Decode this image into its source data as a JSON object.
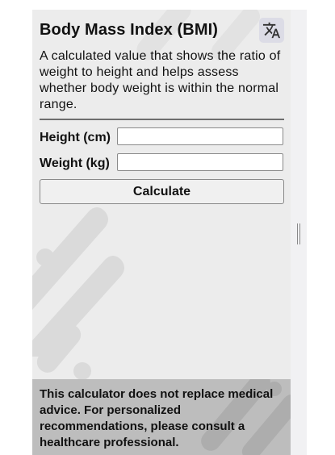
{
  "header": {
    "title": "Body Mass Index (BMI)",
    "translate_icon": "translate-icon"
  },
  "description": "A calculated value that shows the ratio of weight to height and helps assess whether body weight is within the normal range.",
  "form": {
    "height_label": "Height (cm)",
    "height_value": "",
    "weight_label": "Weight (kg)",
    "weight_value": "",
    "calculate_label": "Calculate"
  },
  "disclaimer": "This calculator does not replace medical advice. For personalized recommendations, please consult a healthcare professional.",
  "colors": {
    "panel_background": "#ececec",
    "disclaimer_background": "#bdbdbd",
    "translate_button": "#dcdce6"
  }
}
